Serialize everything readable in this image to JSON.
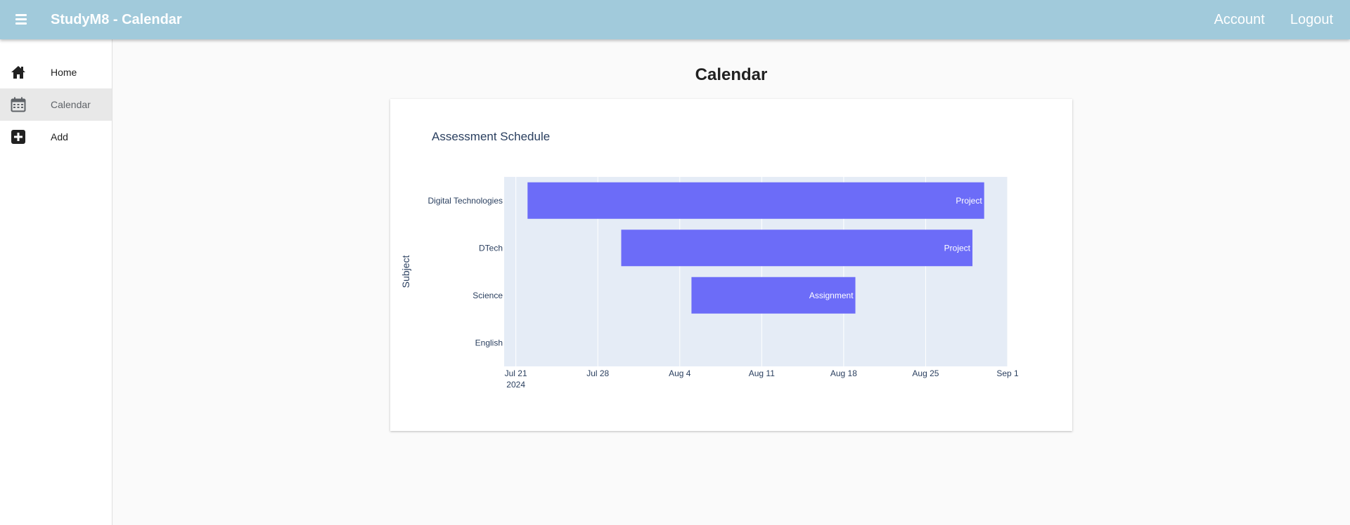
{
  "header": {
    "title": "StudyM8 - Calendar",
    "links": [
      {
        "label": "Account"
      },
      {
        "label": "Logout"
      }
    ]
  },
  "sidebar": {
    "items": [
      {
        "label": "Home",
        "icon": "home-icon",
        "active": false
      },
      {
        "label": "Calendar",
        "icon": "calendar-icon",
        "active": true
      },
      {
        "label": "Add",
        "icon": "plus-box-icon",
        "active": false
      }
    ]
  },
  "main": {
    "heading": "Calendar"
  },
  "colors": {
    "header_bg": "#a1cadb",
    "bar": "#6c6cf8",
    "plot_bg": "#e5ecf6",
    "text": "#2a3f5f"
  },
  "chart_data": {
    "type": "timeline",
    "title": "Assessment Schedule",
    "ylabel": "Subject",
    "xlabel": "",
    "categories": [
      "Digital Technologies",
      "DTech",
      "Science",
      "English"
    ],
    "bars": [
      {
        "category": "Digital Technologies",
        "label": "Project",
        "start": "2024-07-22",
        "end": "2024-08-30"
      },
      {
        "category": "DTech",
        "label": "Project",
        "start": "2024-07-30",
        "end": "2024-08-29"
      },
      {
        "category": "Science",
        "label": "Assignment",
        "start": "2024-08-05",
        "end": "2024-08-19"
      }
    ],
    "x_ticks": [
      "Jul 21",
      "Jul 28",
      "Aug 4",
      "Aug 11",
      "Aug 18",
      "Aug 25",
      "Sep 1"
    ],
    "x_tick_subtitle": "2024",
    "xlim": [
      "2024-07-20",
      "2024-09-01"
    ],
    "grid": true
  }
}
